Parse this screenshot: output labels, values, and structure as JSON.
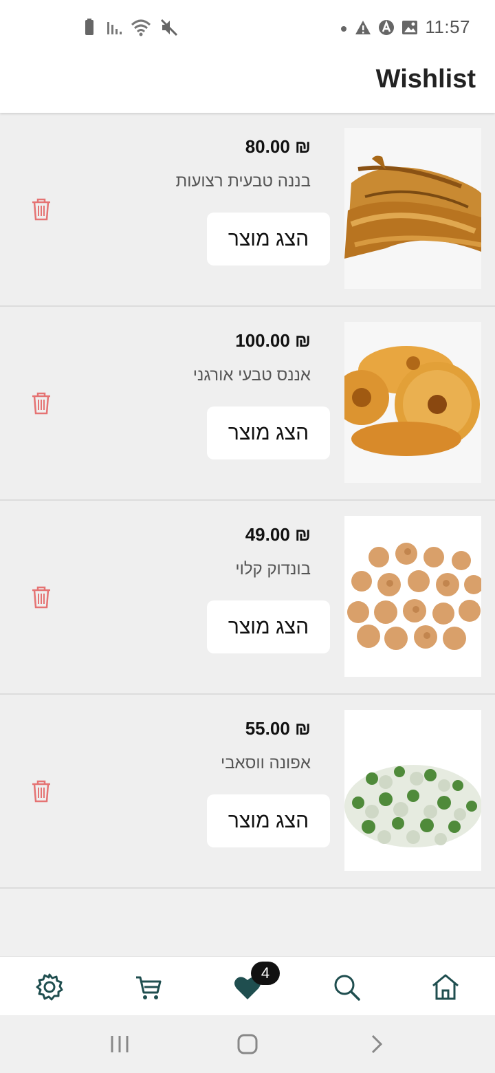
{
  "status_bar": {
    "time": "11:57",
    "left_icons": [
      "battery-icon",
      "signal-icon",
      "wifi-icon",
      "mute-icon"
    ],
    "right_icons": [
      "dot-icon",
      "warning-icon",
      "a-badge-icon",
      "image-icon"
    ]
  },
  "header": {
    "title": "Wishlist"
  },
  "items": [
    {
      "price": "₪ 80.00",
      "name": "בננה טבעית רצועות",
      "button": "הצג מוצר",
      "image_icon": "dried-banana-image"
    },
    {
      "price": "₪ 100.00",
      "name": "אננס טבעי אורגני",
      "button": "הצג מוצר",
      "image_icon": "dried-pineapple-image"
    },
    {
      "price": "₪ 49.00",
      "name": "בונדוק קלוי",
      "button": "הצג מוצר",
      "image_icon": "roasted-peanuts-image"
    },
    {
      "price": "₪ 55.00",
      "name": "אפונה ווסאבי",
      "button": "הצג מוצר",
      "image_icon": "wasabi-peas-image"
    }
  ],
  "bottom_nav": {
    "items": [
      "settings-icon",
      "cart-icon",
      "heart-icon",
      "search-icon",
      "home-icon"
    ],
    "wishlist_badge": "4",
    "accent_color": "#1f4e4f"
  },
  "colors": {
    "delete": "#e57373",
    "price": "#111111",
    "name": "#555555"
  }
}
